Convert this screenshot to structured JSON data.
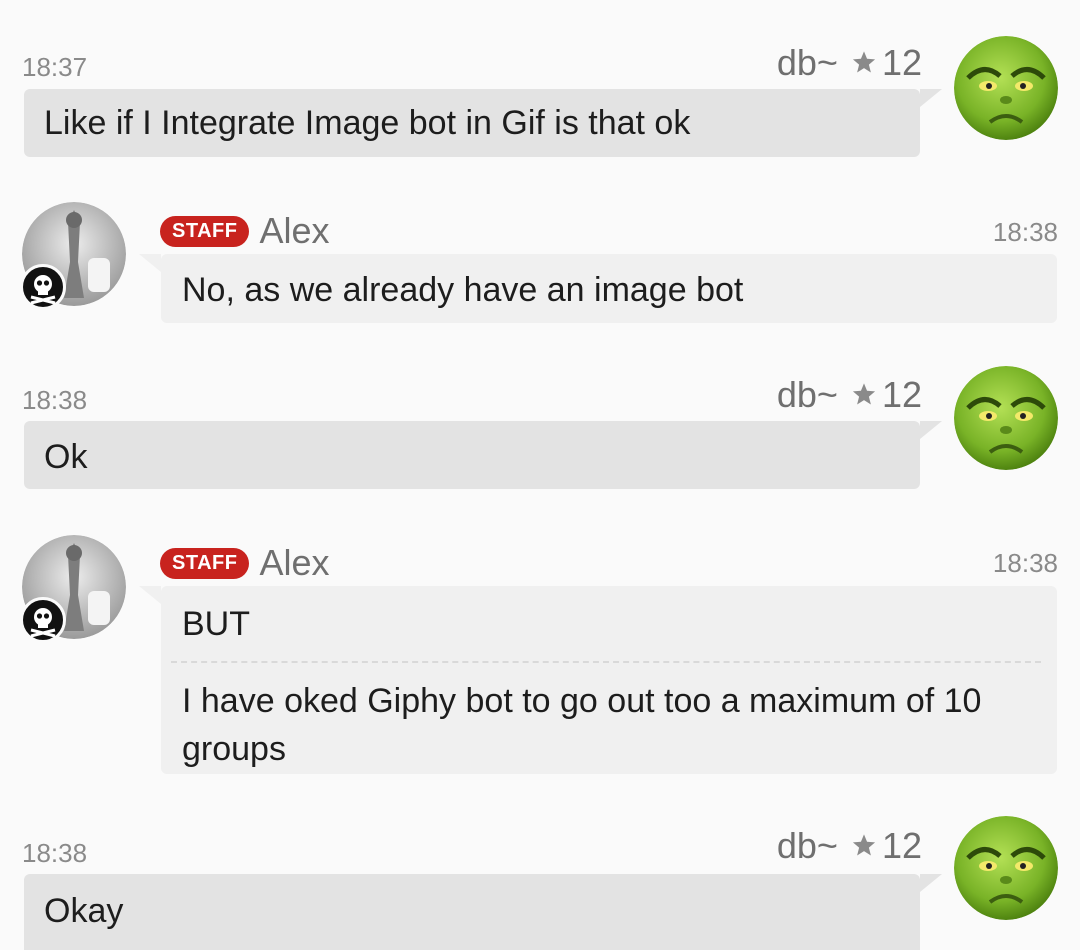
{
  "messages": [
    {
      "sender": "db~",
      "reputation": "12",
      "time": "18:37",
      "text": "Like if I Integrate Image bot in Gif is that ok"
    },
    {
      "sender": "Alex",
      "badge": "STAFF",
      "time": "18:38",
      "text": "No, as we already have an image bot"
    },
    {
      "sender": "db~",
      "reputation": "12",
      "time": "18:38",
      "text": "Ok"
    },
    {
      "sender": "Alex",
      "badge": "STAFF",
      "time": "18:38",
      "parts": [
        "BUT",
        "I have oked Giphy bot to go out too a maximum of 10 groups"
      ]
    },
    {
      "sender": "db~",
      "reputation": "12",
      "time": "18:38",
      "text": "Okay"
    }
  ],
  "colors": {
    "staff_badge": "#c8231e",
    "outgoing_bubble": "#e3e3e3",
    "incoming_bubble": "#f0f0f0",
    "grinch_green": "#8bc63e"
  }
}
